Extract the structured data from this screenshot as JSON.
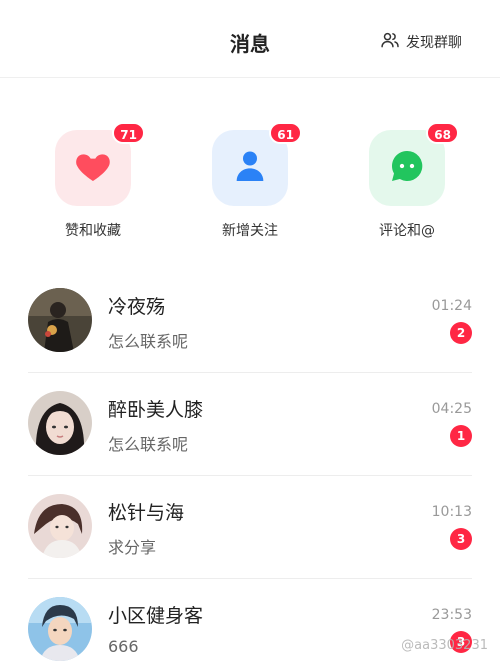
{
  "header": {
    "title": "消息",
    "discover_label": "发现群聊",
    "discover_icon": "users-icon"
  },
  "quick_actions": [
    {
      "label": "赞和收藏",
      "badge": "71",
      "icon": "heart-icon",
      "tile_color": "#fde8ea",
      "icon_color": "#ff4d5e"
    },
    {
      "label": "新增关注",
      "badge": "61",
      "icon": "person-icon",
      "tile_color": "#e6f0fd",
      "icon_color": "#2b82f6"
    },
    {
      "label": "评论和@",
      "badge": "68",
      "icon": "chat-bubble-icon",
      "tile_color": "#e4f8ec",
      "icon_color": "#22c55e"
    }
  ],
  "chats": [
    {
      "name": "冷夜殇",
      "preview": "怎么联系呢",
      "time": "01:24",
      "unread": "2"
    },
    {
      "name": "醉卧美人膝",
      "preview": "怎么联系呢",
      "time": "04:25",
      "unread": "1"
    },
    {
      "name": "松针与海",
      "preview": "求分享",
      "time": "10:13",
      "unread": "3"
    },
    {
      "name": "小区健身客",
      "preview": "666",
      "time": "23:53",
      "unread": "3"
    }
  ],
  "watermark": "@aa3303231",
  "colors": {
    "badge": "#ff2744",
    "divider": "#ededed"
  }
}
